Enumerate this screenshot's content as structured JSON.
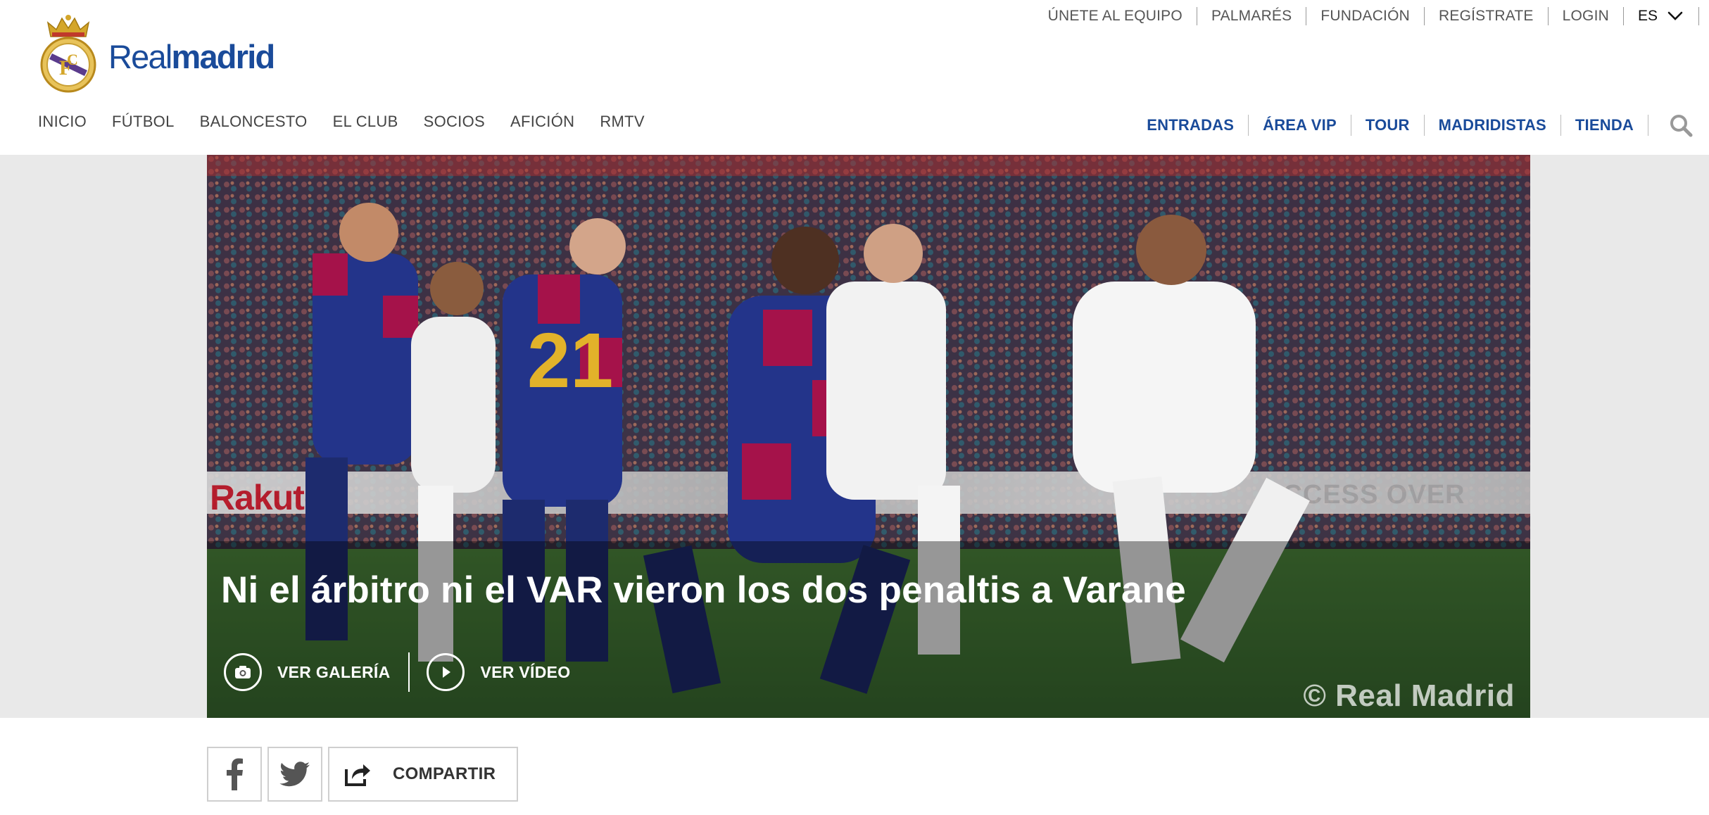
{
  "top_links": [
    {
      "label": "ÚNETE AL EQUIPO"
    },
    {
      "label": "PALMARÉS"
    },
    {
      "label": "FUNDACIÓN"
    },
    {
      "label": "REGÍSTRATE"
    },
    {
      "label": "LOGIN"
    }
  ],
  "language": {
    "selected": "ES"
  },
  "logo": {
    "word_light": "Real",
    "word_bold": "madrid"
  },
  "main_nav": [
    {
      "label": "INICIO"
    },
    {
      "label": "FÚTBOL"
    },
    {
      "label": "BALONCESTO"
    },
    {
      "label": "EL CLUB"
    },
    {
      "label": "SOCIOS"
    },
    {
      "label": "AFICIÓN"
    },
    {
      "label": "RMTV"
    }
  ],
  "right_nav": [
    {
      "label": "ENTRADAS"
    },
    {
      "label": "ÁREA VIP"
    },
    {
      "label": "TOUR"
    },
    {
      "label": "MADRIDISTAS"
    },
    {
      "label": "TIENDA"
    }
  ],
  "hero": {
    "headline": "Ni el árbitro ni el VAR vieron los dos penaltis a Varane",
    "gallery_label": "VER GALERÍA",
    "video_label": "VER VÍDEO",
    "watermark": "© Real Madrid",
    "board_text_left": "Rakuten",
    "board_text_right": "ACCESS OVER"
  },
  "share": {
    "label": "COMPARTIR"
  },
  "colors": {
    "brand_blue": "#1a4b9a",
    "nav_gray": "#444444",
    "band_gray": "#e9e9e9"
  }
}
